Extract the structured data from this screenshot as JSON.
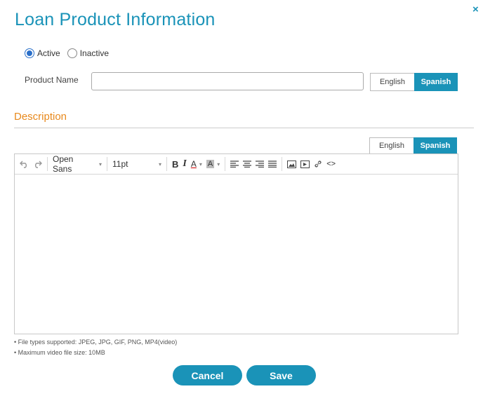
{
  "dialog": {
    "title": "Loan Product Information",
    "close_icon": "close-icon",
    "close_glyph": "×"
  },
  "status": {
    "options": [
      {
        "label": "Active",
        "checked": true
      },
      {
        "label": "Inactive",
        "checked": false
      }
    ]
  },
  "product_name": {
    "label": "Product Name",
    "value": "",
    "placeholder": ""
  },
  "language_toggle_top": {
    "options": [
      "English",
      "Spanish"
    ],
    "selected": "Spanish"
  },
  "description": {
    "title": "Description",
    "language_toggle": {
      "options": [
        "English",
        "Spanish"
      ],
      "selected": "Spanish"
    },
    "toolbar": {
      "undo_icon": "undo-icon",
      "redo_icon": "redo-icon",
      "font_family": "Open Sans",
      "font_size": "11pt",
      "bold_glyph": "B",
      "italic_glyph": "I",
      "font_color_glyph": "A",
      "bg_color_glyph": "A",
      "code_glyph": "<>"
    },
    "content": ""
  },
  "notes": [
    "• File types supported: JPEG, JPG, GIF, PNG, MP4(video)",
    "• Maximum video file size: 10MB"
  ],
  "actions": {
    "cancel_label": "Cancel",
    "save_label": "Save"
  },
  "colors": {
    "accent": "#1a93b8",
    "section_title": "#e8891c"
  }
}
